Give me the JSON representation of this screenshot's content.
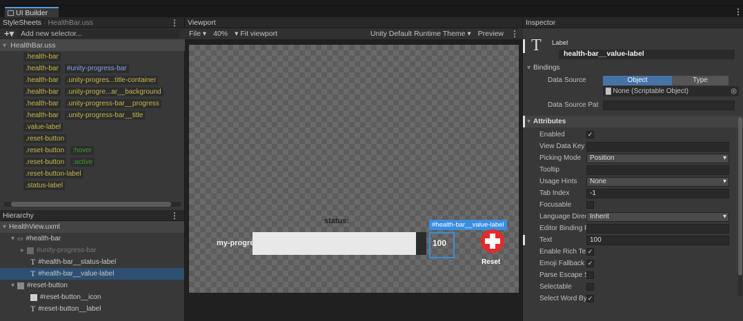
{
  "window": {
    "tab_label": "UI Builder"
  },
  "stylesheets": {
    "header": "StyleSheets",
    "header_file": "HealthBar.uss",
    "add_selector": "Add new selector...",
    "file": "HealthBar.uss",
    "rows": [
      [
        "",
        ".health-bar"
      ],
      [
        ".health-bar",
        "#unity-progress-bar"
      ],
      [
        ".health-bar",
        ".unity-progres...title-container"
      ],
      [
        ".health-bar",
        ".unity-progre...ar__background"
      ],
      [
        ".health-bar",
        ".unity-progress-bar__progress"
      ],
      [
        ".health-bar",
        ".unity-progress-bar__title"
      ]
    ],
    "single": [
      ".value-label",
      ".reset-button"
    ],
    "pseudo": [
      [
        ".reset-button",
        ":hover"
      ],
      [
        ".reset-button",
        ":active"
      ]
    ],
    "tail": [
      ".reset-button-label",
      ".status-label"
    ]
  },
  "hierarchy": {
    "header": "Hierarchy",
    "items": [
      "HealthView.uxml",
      "#health-bar",
      "#unity-progress-bar",
      "#health-bar__status-label",
      "#health-bar__value-label",
      "#reset-button",
      "#reset-button__icon",
      "#reset-button__label"
    ]
  },
  "viewport": {
    "header": "Viewport",
    "file_menu": "File ▾",
    "zoom": "40%",
    "fit": "Fit viewport",
    "theme": "Unity Default Runtime Theme ▾",
    "preview": "Preview",
    "status_label": "status:",
    "bar_title": "my-progress",
    "value_label": "100",
    "selection_tag": "#health-bar__value-label",
    "reset_label": "Reset"
  },
  "inspector": {
    "header": "Inspector",
    "type": "Label",
    "name": "health-bar__value-label",
    "bindings": "Bindings",
    "data_source_label": "Data Source",
    "object_btn": "Object",
    "type_btn": "Type",
    "none_source": "None (Scriptable Object)",
    "data_source_path": "Data Source Pat",
    "attributes": "Attributes",
    "fields": [
      {
        "label": "Enabled",
        "kind": "check",
        "value": "✓"
      },
      {
        "label": "View Data Key",
        "kind": "text",
        "value": ""
      },
      {
        "label": "Picking Mode",
        "kind": "drop",
        "value": "Position"
      },
      {
        "label": "Tooltip",
        "kind": "text",
        "value": ""
      },
      {
        "label": "Usage Hints",
        "kind": "drop",
        "value": "None"
      },
      {
        "label": "Tab Index",
        "kind": "text",
        "value": "-1"
      },
      {
        "label": "Focusable",
        "kind": "check",
        "value": ""
      },
      {
        "label": "Language Directio",
        "kind": "drop",
        "value": "Inherit"
      },
      {
        "label": "Editor Binding Pat",
        "kind": "text",
        "value": ""
      },
      {
        "label": "Text",
        "kind": "text",
        "value": "100"
      },
      {
        "label": "Enable Rich Text",
        "kind": "check",
        "value": "✓"
      },
      {
        "label": "Emoji Fallback Sup",
        "kind": "check",
        "value": "✓"
      },
      {
        "label": "Parse Escape Seq",
        "kind": "check",
        "value": ""
      },
      {
        "label": "Selectable",
        "kind": "check",
        "value": ""
      },
      {
        "label": "Select Word By Dc",
        "kind": "check",
        "value": "✓"
      }
    ]
  }
}
